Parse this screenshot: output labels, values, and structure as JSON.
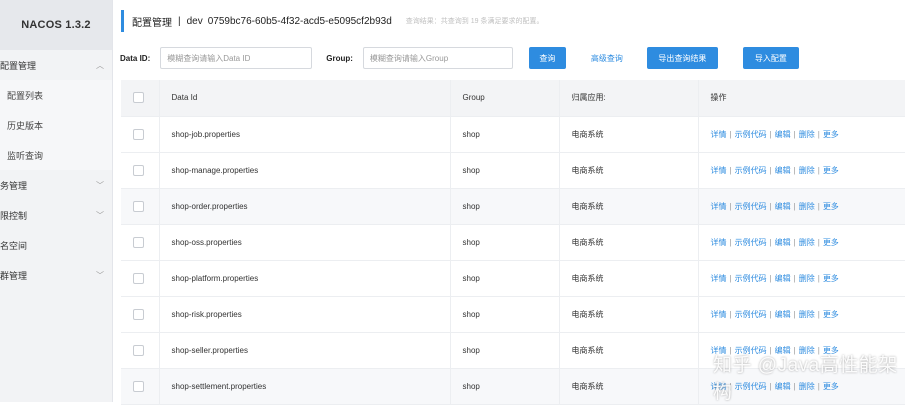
{
  "app": {
    "brand": "NACOS 1.3.2"
  },
  "sidebar": {
    "items": [
      {
        "label": "配置管理",
        "chev": "︿"
      },
      {
        "label": "配置列表"
      },
      {
        "label": "历史版本"
      },
      {
        "label": "监听查询"
      },
      {
        "label": "务管理",
        "chev": "﹀"
      },
      {
        "label": "限控制",
        "chev": "﹀"
      },
      {
        "label": "名空间"
      },
      {
        "label": "群管理",
        "chev": "﹀"
      }
    ]
  },
  "header": {
    "title": "配置管理",
    "separator": "|",
    "namespace": "dev",
    "namespace_id": "0759bc76-60b5-4f32-acd5-e5095cf2b93d",
    "query_result": "查询结果：共查询到 19 条满足要求的配置。"
  },
  "filters": {
    "dataid_label": "Data ID:",
    "dataid_placeholder": "模糊查询请输入Data ID",
    "group_label": "Group:",
    "group_placeholder": "模糊查询请输入Group",
    "query_button": "查询",
    "advanced_query": "高级查询",
    "export_button": "导出查询结果",
    "import_button": "导入配置"
  },
  "table": {
    "headers": {
      "dataid": "Data Id",
      "group": "Group",
      "app": "归属应用:",
      "ops": "操作"
    },
    "ops_labels": {
      "detail": "详情",
      "sample": "示例代码",
      "edit": "编辑",
      "delete": "删除",
      "more": "更多",
      "pipe": "|"
    },
    "rows": [
      {
        "dataid": "shop-job.properties",
        "group": "shop",
        "app": "电商系统"
      },
      {
        "dataid": "shop-manage.properties",
        "group": "shop",
        "app": "电商系统"
      },
      {
        "dataid": "shop-order.properties",
        "group": "shop",
        "app": "电商系统"
      },
      {
        "dataid": "shop-oss.properties",
        "group": "shop",
        "app": "电商系统"
      },
      {
        "dataid": "shop-platform.properties",
        "group": "shop",
        "app": "电商系统"
      },
      {
        "dataid": "shop-risk.properties",
        "group": "shop",
        "app": "电商系统"
      },
      {
        "dataid": "shop-seller.properties",
        "group": "shop",
        "app": "电商系统"
      },
      {
        "dataid": "shop-settlement.properties",
        "group": "shop",
        "app": "电商系统"
      }
    ]
  },
  "watermark": "知乎 @Java高性能架构",
  "colors": {
    "accent": "#2e8ce0",
    "sidebar_bg": "#f2f3f5",
    "header_bg": "#f3f4f6"
  }
}
